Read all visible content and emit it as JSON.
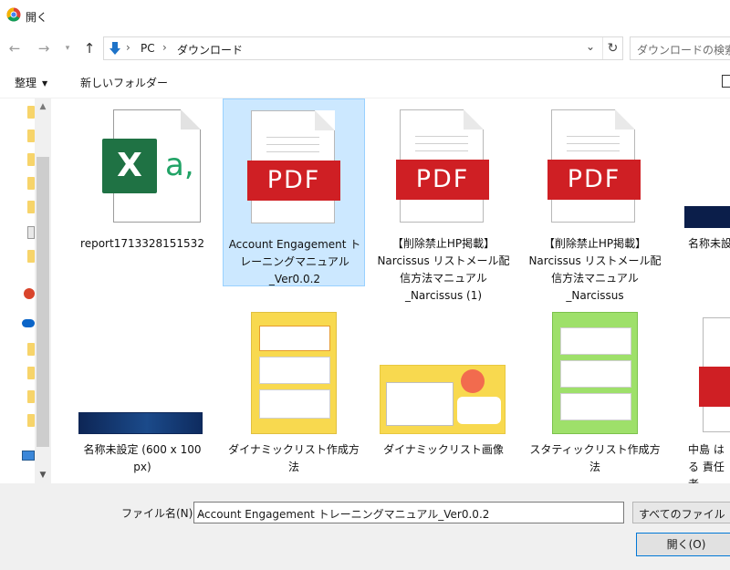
{
  "window": {
    "title": "開く"
  },
  "nav": {
    "back_icon": "arrow-left-icon",
    "forward_icon": "arrow-right-icon",
    "up_icon": "arrow-up-icon",
    "breadcrumb": [
      "PC",
      "ダウンロード"
    ],
    "search_placeholder": "ダウンロードの検索"
  },
  "toolbar": {
    "organize_label": "整理",
    "new_folder_label": "新しいフォルダー"
  },
  "files": [
    {
      "name": "report1713328151532",
      "kind": "excel",
      "selected": false
    },
    {
      "name": "Account Engagement トレーニングマニュアル_Ver0.0.2",
      "kind": "pdf",
      "selected": true
    },
    {
      "name": "【削除禁止HP掲載】Narcissus リストメール配信方法マニュアル_Narcissus (1)",
      "kind": "pdf",
      "selected": false
    },
    {
      "name": "【削除禁止HP掲載】Narcissus リストメール配信方法マニュアル_Narcissus",
      "kind": "pdf",
      "selected": false
    },
    {
      "name": "名称未設",
      "kind": "image",
      "selected": false
    },
    {
      "name": "名称未設定 (600 x 100 px)",
      "kind": "image",
      "selected": false
    },
    {
      "name": "ダイナミックリスト作成方法",
      "kind": "image",
      "selected": false
    },
    {
      "name": "ダイナミックリスト画像",
      "kind": "image",
      "selected": false
    },
    {
      "name": "スタティックリスト作成方法",
      "kind": "image",
      "selected": false
    },
    {
      "name": "中島 はる責任者",
      "kind": "pdf",
      "selected": false
    }
  ],
  "labels": {
    "tile0": "report1713328151532",
    "tile1": "Account Engagement トレーニングマニュアル _Ver0.0.2",
    "tile2": "【削除禁止HP掲載】 Narcissus リストメール配 信方法マニュアル _Narcissus (1)",
    "tile3": "【削除禁止HP掲載】 Narcissus リストメール配 信方法マニュアル _Narcissus",
    "tile4": "名称未設",
    "tile5": "名称未設定 (600 x 100 px)",
    "tile6": "ダイナミックリスト作成方 法",
    "tile7": "ダイナミックリスト画像",
    "tile8": "スタティックリスト作成方 法",
    "tile9": "中島 はる 責任者"
  },
  "pdf_badge_text": "PDF",
  "excel_letter": "X",
  "excel_suffix": "a,",
  "footer": {
    "filename_label": "ファイル名(N):",
    "filename_value": "Account Engagement トレーニングマニュアル_Ver0.0.2",
    "filter_value": "すべてのファイル",
    "open_button": "開く(O)"
  },
  "colors": {
    "selection": "#cce8ff",
    "pdf_red": "#cf1f24",
    "excel_green": "#1f7244",
    "accent": "#0078d7"
  }
}
